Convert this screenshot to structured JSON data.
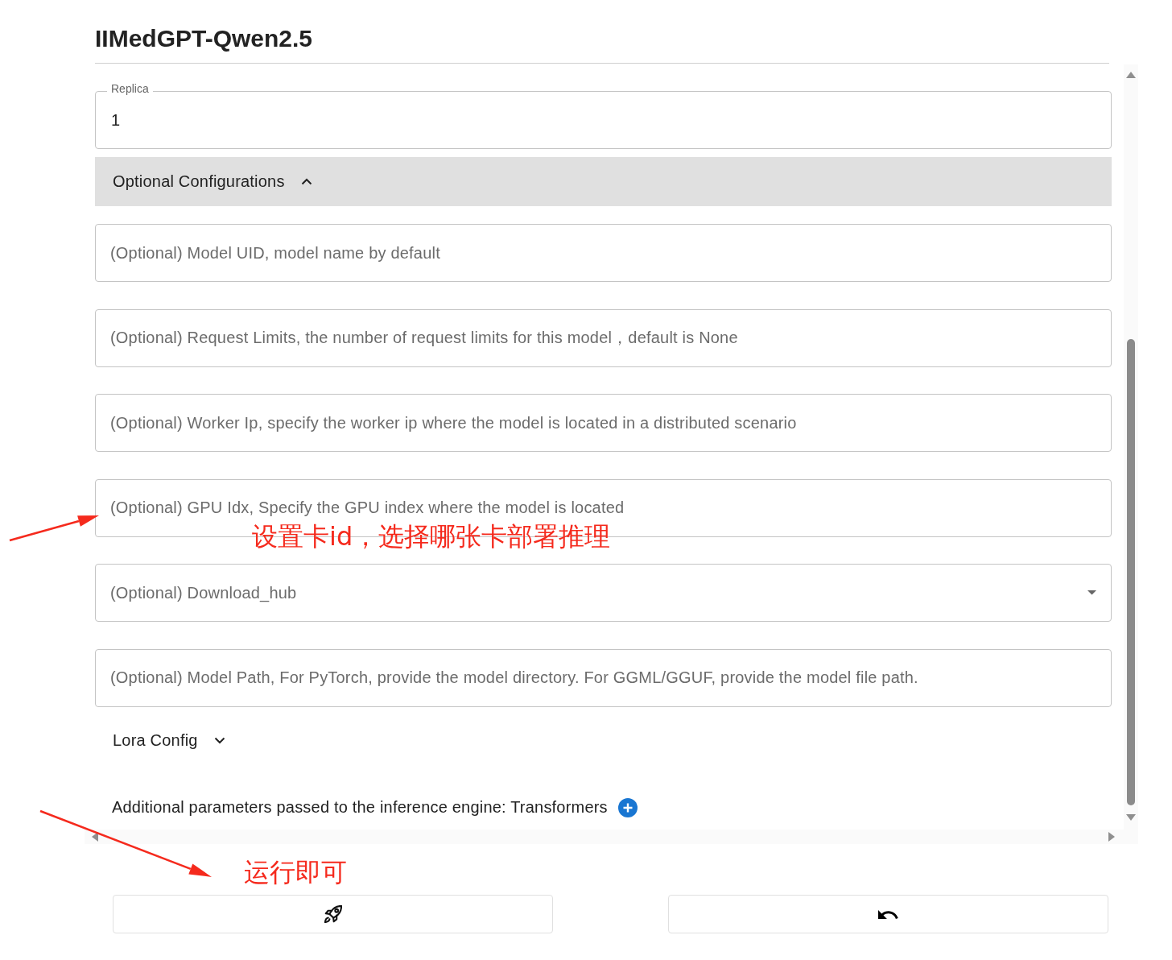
{
  "title": "IIMedGPT-Qwen2.5",
  "replica": {
    "label": "Replica",
    "value": "1"
  },
  "optional_configurations": {
    "label": "Optional Configurations",
    "expanded": true,
    "fields": [
      {
        "kind": "text",
        "placeholder": "(Optional) Model UID, model name by default"
      },
      {
        "kind": "text",
        "placeholder": "(Optional) Request Limits, the number of request limits for this model，default is None"
      },
      {
        "kind": "text",
        "placeholder": "(Optional) Worker Ip, specify the worker ip where the model is located in a distributed scenario"
      },
      {
        "kind": "text",
        "placeholder": "(Optional) GPU Idx, Specify the GPU index where the model is located"
      },
      {
        "kind": "select",
        "placeholder": "(Optional) Download_hub"
      },
      {
        "kind": "text",
        "placeholder": "(Optional) Model Path, For PyTorch, provide the model directory. For GGML/GGUF, provide the model file path."
      }
    ]
  },
  "lora_config": {
    "label": "Lora Config",
    "expanded": false
  },
  "additional_parameters": {
    "label": "Additional parameters passed to the inference engine: Transformers"
  },
  "buttons": [
    {
      "kind": "launch"
    },
    {
      "kind": "reset"
    }
  ],
  "annotations": [
    {
      "text": "设置卡id，选择哪张卡部署推理"
    },
    {
      "text": "运行即可"
    }
  ]
}
